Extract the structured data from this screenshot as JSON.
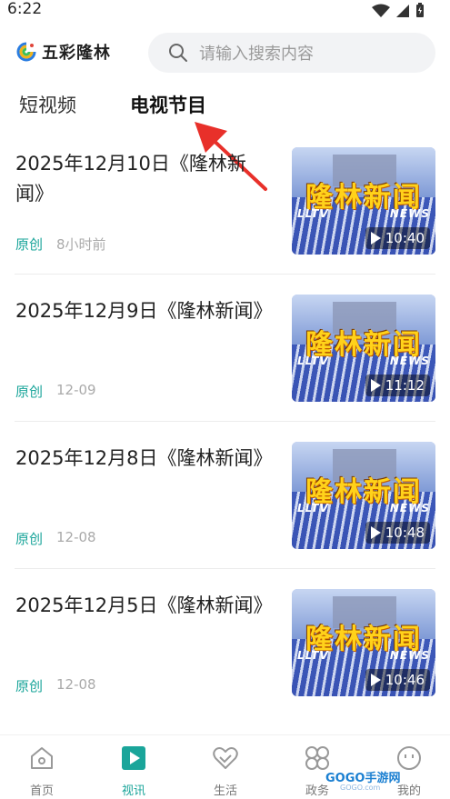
{
  "status_bar": {
    "time": "6:22"
  },
  "header": {
    "logo_text": "五彩隆林",
    "search_placeholder": "请输入搜索内容"
  },
  "tabs": [
    {
      "label": "短视频"
    },
    {
      "label": "电视节目",
      "active": true
    }
  ],
  "items": [
    {
      "title": "2025年12月10日《隆林新闻》",
      "tag": "原创",
      "time": "8小时前",
      "thumb_title": "隆林新闻",
      "thumb_sub_left": "LLTV",
      "thumb_sub_right": "NEWS",
      "duration": "10:40"
    },
    {
      "title": "2025年12月9日《隆林新闻》",
      "tag": "原创",
      "time": "12-09",
      "thumb_title": "隆林新闻",
      "thumb_sub_left": "LLTV",
      "thumb_sub_right": "NEWS",
      "duration": "11:12"
    },
    {
      "title": "2025年12月8日《隆林新闻》",
      "tag": "原创",
      "time": "12-08",
      "thumb_title": "隆林新闻",
      "thumb_sub_left": "LLTV",
      "thumb_sub_right": "NEWS",
      "duration": "10:48"
    },
    {
      "title": "2025年12月5日《隆林新闻》",
      "tag": "原创",
      "time": "12-08",
      "thumb_title": "隆林新闻",
      "thumb_sub_left": "LLTV",
      "thumb_sub_right": "NEWS",
      "duration": "10:46"
    }
  ],
  "bottom_nav": [
    {
      "label": "首页",
      "icon": "home-icon"
    },
    {
      "label": "视讯",
      "icon": "video-icon",
      "active": true
    },
    {
      "label": "生活",
      "icon": "heart-icon"
    },
    {
      "label": "政务",
      "icon": "grid-icon"
    },
    {
      "label": "我的",
      "icon": "smile-icon"
    }
  ],
  "watermark": {
    "text": "GOGO手游网",
    "sub": "GOGO.com"
  },
  "colors": {
    "accent": "#1aa59a",
    "arrow": "#e8302a"
  }
}
